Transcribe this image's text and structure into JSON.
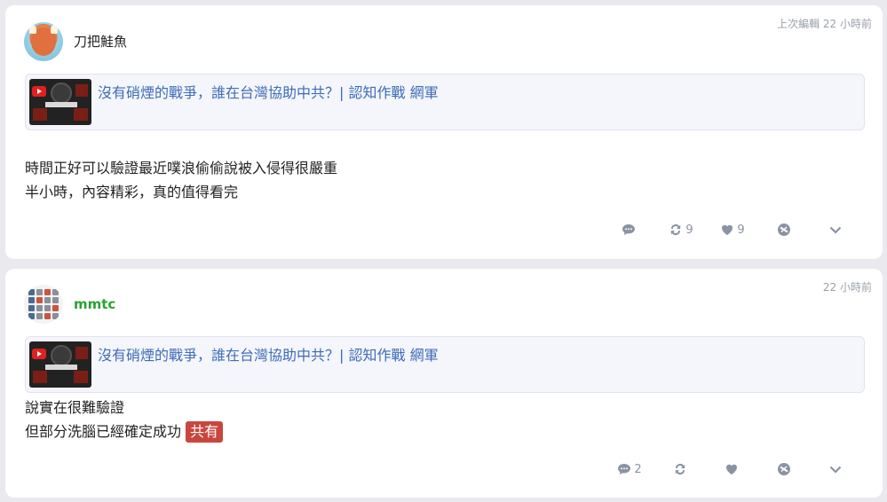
{
  "posts": [
    {
      "username": "刀把鮭魚",
      "timestamp": "上次編輯 22 小時前",
      "link_title": "沒有硝煙的戰爭，誰在台灣協助中共？| 認知作戰 網軍",
      "content_lines": [
        "時間正好可以驗證最近噗浪偷偷說被入侵得很嚴重",
        "半小時，內容精彩，真的值得看完"
      ],
      "actions": {
        "comment": "",
        "replurk": "9",
        "like": "9"
      }
    },
    {
      "username": "mmtc",
      "timestamp": "22 小時前",
      "link_title": "沒有硝煙的戰爭，誰在台灣協助中共？| 認知作戰 網軍",
      "content_lines": [
        "說實在很難驗證",
        "但部分洗腦已經確定成功"
      ],
      "tag": "共有",
      "actions": {
        "comment": "2",
        "replurk": "",
        "like": ""
      }
    }
  ],
  "icons": {
    "comment": "comment-icon",
    "replurk": "replurk-icon",
    "like": "heart-icon",
    "mute": "mute-icon",
    "more": "chevron-down-icon"
  },
  "colors": {
    "link": "#3c6cb8",
    "username_highlight": "#2aa331",
    "tag_bg": "#c9463d",
    "icon": "#8a93a3"
  }
}
